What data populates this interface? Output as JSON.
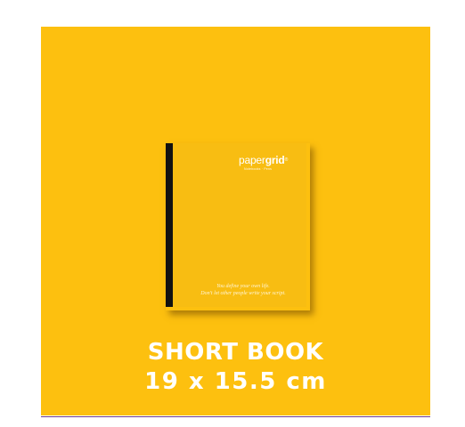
{
  "product": {
    "title": "SHORT BOOK",
    "size": "19 x 15.5 cm"
  },
  "book_cover": {
    "logo_left": "paper",
    "logo_right": "grid",
    "logo_mark": "®",
    "logo_tagline": "Notebooks · Pens",
    "quote_line_1": "You define your own life.",
    "quote_line_2": "Don't let other people write your script."
  },
  "colors": {
    "background": "#fdc00f",
    "cover": "#f8bd12",
    "spine": "#111111",
    "title_text": "#ffffff",
    "rule": "#6f3d8f"
  }
}
